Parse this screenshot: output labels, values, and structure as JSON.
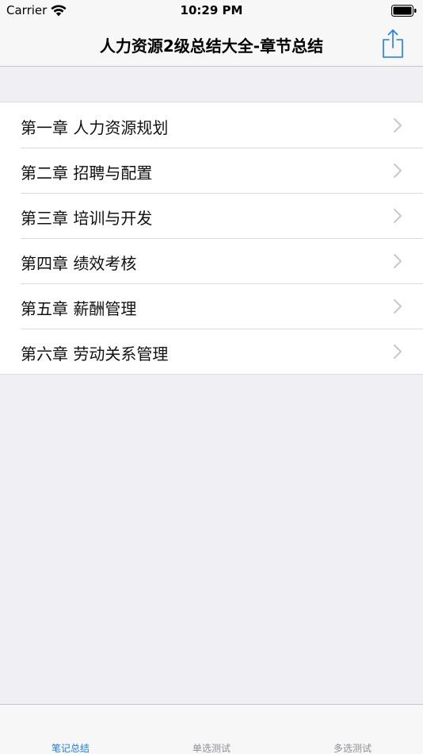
{
  "status_bar": {
    "carrier": "Carrier",
    "time": "10:29 PM"
  },
  "nav": {
    "title": "人力资源2级总结大全-章节总结",
    "share_icon": "share-icon"
  },
  "chapters": [
    {
      "label": "第一章 人力资源规划"
    },
    {
      "label": "第二章 招聘与配置"
    },
    {
      "label": "第三章 培训与开发"
    },
    {
      "label": "第四章 绩效考核"
    },
    {
      "label": "第五章 薪酬管理"
    },
    {
      "label": "第六章 劳动关系管理"
    }
  ],
  "tabs": [
    {
      "label": "笔记总结",
      "active": true
    },
    {
      "label": "单选测试",
      "active": false
    },
    {
      "label": "多选测试",
      "active": false
    }
  ],
  "colors": {
    "accent": "#1a7cf7",
    "background": "#efeff4",
    "separator": "#dcdce0",
    "inactive_tab": "#8e8e93"
  }
}
